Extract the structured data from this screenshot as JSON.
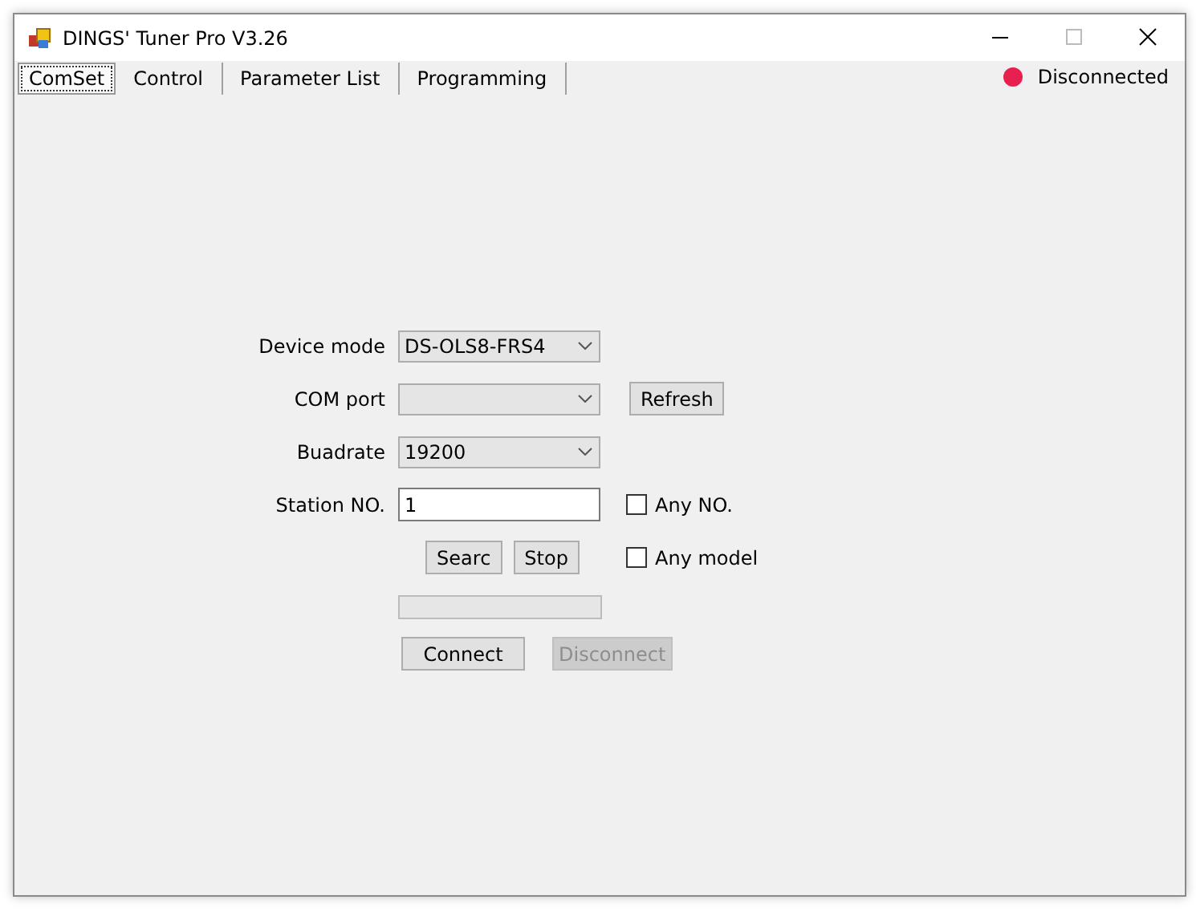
{
  "window": {
    "title": "DINGS' Tuner Pro V3.26"
  },
  "tabs": [
    {
      "label": "ComSet",
      "selected": true
    },
    {
      "label": "Control",
      "selected": false
    },
    {
      "label": "Parameter List",
      "selected": false
    },
    {
      "label": "Programming",
      "selected": false
    }
  ],
  "status": {
    "text": "Disconnected",
    "connected": false
  },
  "form": {
    "rows": [
      {
        "kind": "dropdown",
        "label": "Device mode",
        "value": "DS-OLS8-FRS4"
      },
      {
        "kind": "dropdown",
        "label": "COM port",
        "button": {
          "label": "Refresh",
          "disabled": false
        }
      },
      {
        "kind": "dropdown",
        "label": "Buadrate",
        "value": "19200"
      },
      {
        "kind": "input",
        "label": "Station NO.",
        "value": "1",
        "checkbox": {
          "label": "Any NO.",
          "checked": false
        }
      },
      {
        "kind": "buttons",
        "buttons": [
          {
            "label": "Searc",
            "disabled": false
          },
          {
            "label": "Stop",
            "disabled": false
          }
        ],
        "checkbox": {
          "label": "Any model",
          "checked": false
        }
      },
      {
        "kind": "progress",
        "level": 0
      }
    ],
    "actions": [
      {
        "label": "Connect",
        "disabled": false
      },
      {
        "label": "Disconnect",
        "disabled": true
      }
    ]
  }
}
